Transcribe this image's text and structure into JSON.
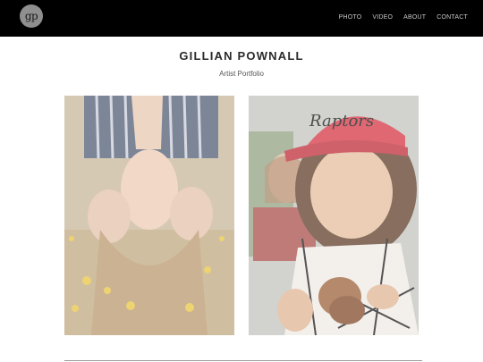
{
  "header": {
    "logo_text": "gp",
    "nav": [
      "PHOTO",
      "VIDEO",
      "ABOUT",
      "CONTACT"
    ]
  },
  "page": {
    "title": "GILLIAN POWNALL",
    "subtitle": "Artist Portfolio"
  },
  "photos": [
    {
      "subject": "woman lying upside down on grass with yellow flowers covering eyes"
    },
    {
      "subject": "woman in red Raptors cap eating food on a skewer",
      "cap_text": "Raptors"
    }
  ],
  "colors": {
    "topbar": "#000000",
    "logo": "#8f8f8f",
    "cap": "#d8434f"
  }
}
